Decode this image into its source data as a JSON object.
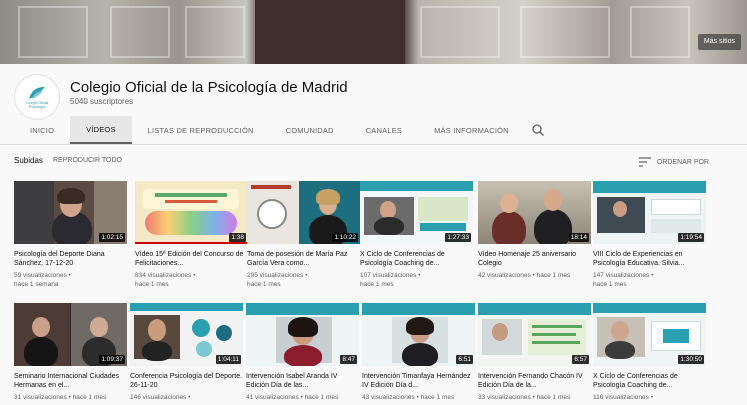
{
  "banner": {
    "links_label": "Más sitios"
  },
  "channel": {
    "name": "Colegio Oficial de la Psicología de Madrid",
    "subscribers": "5040 suscriptores",
    "logo_text": "Colegio Oficial de la Psicología de Madrid"
  },
  "tabs": [
    {
      "label": "INICIO"
    },
    {
      "label": "VÍDEOS"
    },
    {
      "label": "LISTAS DE REPRODUCCIÓN"
    },
    {
      "label": "COMUNIDAD"
    },
    {
      "label": "CANALES"
    },
    {
      "label": "MÁS INFORMACIÓN"
    }
  ],
  "section": {
    "title": "Subidas",
    "play_all": "REPRODUCIR TODO",
    "order": "ORDENAR POR"
  },
  "videos": [
    {
      "title": "Psicología del Deporte Diana Sánchez. 17-12-20",
      "views": "59 visualizaciones •",
      "age": "hace 1 semana",
      "duration": "1:02:15"
    },
    {
      "title": "Vídeo 15ª Edición del Concurso de Felicitaciones...",
      "views": "834 visualizaciones •",
      "age": "hace 1 mes",
      "duration": "1:38"
    },
    {
      "title": "Toma de posesión de María Paz García Vera como...",
      "views": "295 visualizaciones •",
      "age": "hace 1 mes",
      "duration": "1:10:22"
    },
    {
      "title": "X Ciclo de Conferencias de Psicología Coaching de...",
      "views": "107 visualizaciones •",
      "age": "hace 1 mes",
      "duration": "1:27:33"
    },
    {
      "title": "Vídeo Homenaje 25 aniversario Colegio",
      "views": "42 visualizaciones • hace 1 mes",
      "age": "",
      "duration": "18:14"
    },
    {
      "title": "VIII Ciclo de Experiencias en Psicología Educativa. Silvia...",
      "views": "147 visualizaciones •",
      "age": "hace 1 mes",
      "duration": "1:19:54"
    },
    {
      "title": "Seminario Internacional Ciudades Hermanas en el...",
      "views": "31 visualizaciones • hace 1 mes",
      "age": "",
      "duration": "1:09:37"
    },
    {
      "title": "Conferencia Psicología del Deporte. 26-11-20",
      "views": "146 visualizaciones •",
      "age": "",
      "duration": "1:04:11"
    },
    {
      "title": "Intervención Isabel Aranda IV Edición Día de las...",
      "views": "41 visualizaciones • hace 1 mes",
      "age": "",
      "duration": "8:47"
    },
    {
      "title": "Intervención Timanfaya Hernández IV Edición Día d...",
      "views": "43 visualizaciones • hace 1 mes",
      "age": "",
      "duration": "6:51"
    },
    {
      "title": "Intervención Fernando Chacón IV Edición Día de la...",
      "views": "33 visualizaciones • hace 1 mes",
      "age": "",
      "duration": "6:57"
    },
    {
      "title": "X Ciclo de Conferencias de Psicología Coaching de...",
      "views": "116 visualizaciones •",
      "age": "",
      "duration": "1:30:50"
    }
  ],
  "colors": {
    "accent": "#2a9fb0",
    "progress": "#cc0000"
  },
  "icons": {
    "search": "search-icon",
    "sort": "sort-icon",
    "logo": "logo-icon"
  }
}
